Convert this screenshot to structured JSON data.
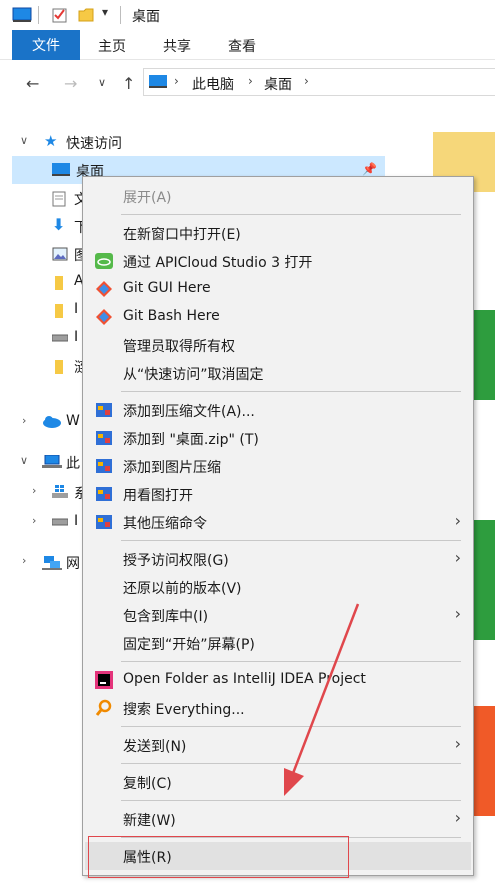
{
  "window": {
    "title": "桌面"
  },
  "ribbon": {
    "file_tab": "文件",
    "tabs": [
      "主页",
      "共享",
      "查看"
    ]
  },
  "address": {
    "crumbs": [
      "此电脑",
      "桌面"
    ]
  },
  "navpane": {
    "quick_access": "快速访问",
    "items": [
      {
        "label": "桌面"
      },
      {
        "label": "文"
      },
      {
        "label": "下"
      },
      {
        "label": "图"
      },
      {
        "label": "A"
      },
      {
        "label": "I"
      },
      {
        "label": "I"
      },
      {
        "label": "涟"
      }
    ],
    "wps": "W",
    "this_pc": "此",
    "pc_items": [
      {
        "label": "系"
      },
      {
        "label": "I"
      }
    ],
    "network": "网"
  },
  "context_menu": {
    "items": [
      {
        "label": "展开(A)"
      },
      {
        "label": "在新窗口中打开(E)"
      },
      {
        "label": "通过 APICloud Studio 3 打开"
      },
      {
        "label": "Git GUI Here"
      },
      {
        "label": "Git Bash Here"
      },
      {
        "label": "管理员取得所有权"
      },
      {
        "label": "从“快速访问”取消固定"
      },
      {
        "label": "添加到压缩文件(A)..."
      },
      {
        "label": "添加到 \"桌面.zip\" (T)"
      },
      {
        "label": "添加到图片压缩"
      },
      {
        "label": "用看图打开"
      },
      {
        "label": "其他压缩命令"
      },
      {
        "label": "授予访问权限(G)"
      },
      {
        "label": "还原以前的版本(V)"
      },
      {
        "label": "包含到库中(I)"
      },
      {
        "label": "固定到“开始”屏幕(P)"
      },
      {
        "label": "Open Folder as IntelliJ IDEA Project"
      },
      {
        "label": "搜索 Everything..."
      },
      {
        "label": "发送到(N)"
      },
      {
        "label": "复制(C)"
      },
      {
        "label": "新建(W)"
      },
      {
        "label": "属性(R)"
      }
    ]
  },
  "colors": {
    "accent": "#1a73c8",
    "selection": "#cce8ff",
    "annotation": "#e0474c"
  }
}
